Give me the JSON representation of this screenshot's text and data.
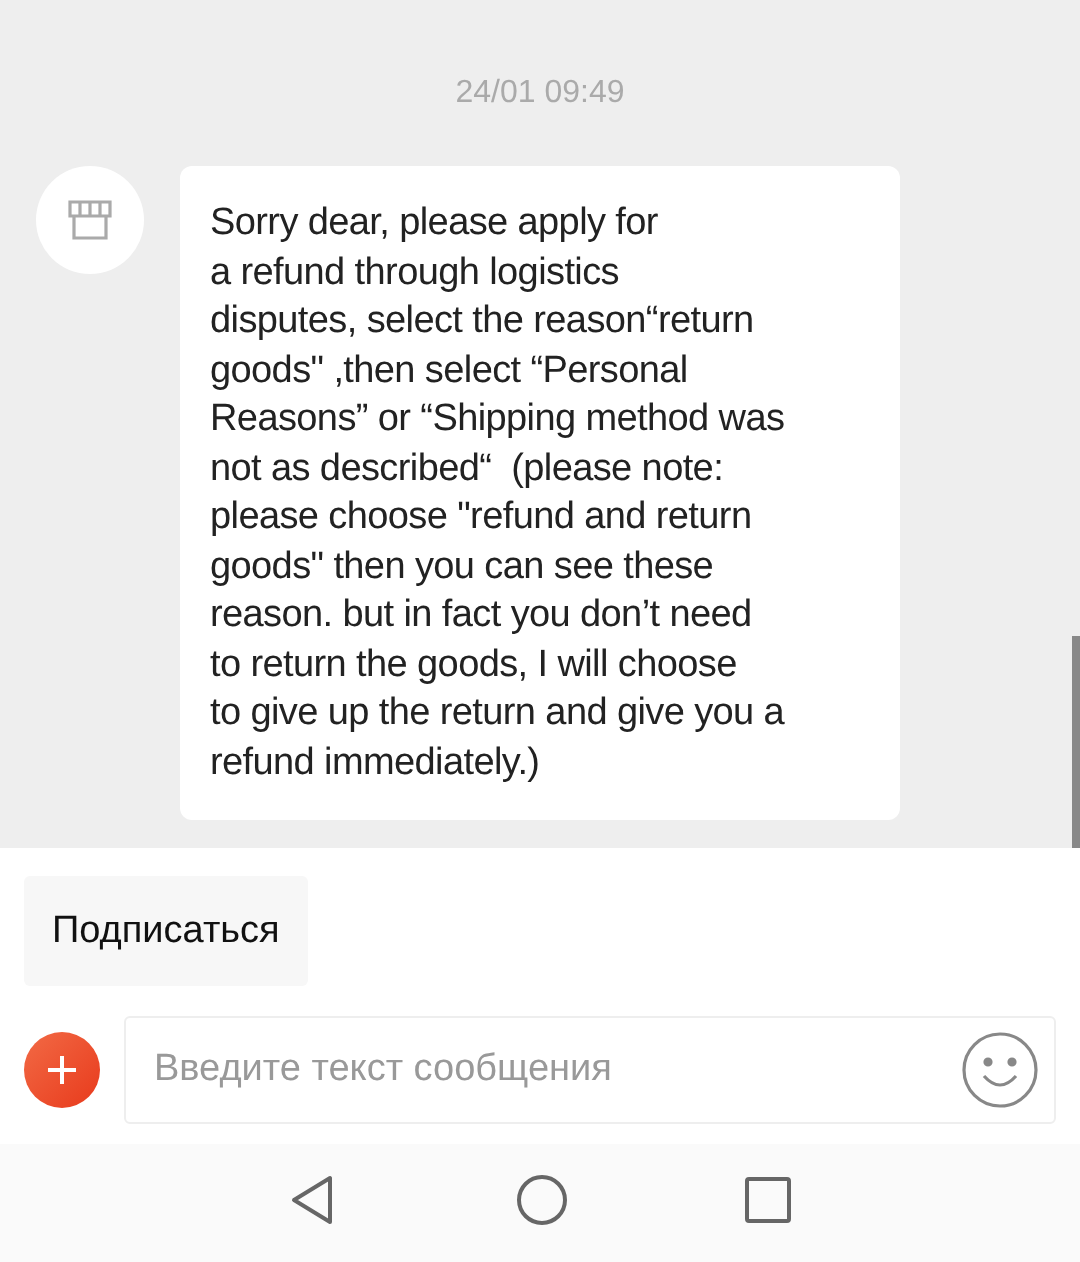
{
  "timestamp": "24/01 09:49",
  "message": {
    "text": "Sorry dear, please apply for\na refund through logistics\ndisputes, select the reason“return\ngoods\" ,then select “Personal\nReasons” or “Shipping method was\nnot as described“  (please note:\nplease choose \"refund and return\ngoods\" then you can see these\nreason. but in fact you don’t need\nto return the goods, I will choose\nto give up the return and give you a\nrefund immediately.)"
  },
  "quick_reply": "Подписаться",
  "input": {
    "placeholder": "Введите текст сообщения"
  }
}
